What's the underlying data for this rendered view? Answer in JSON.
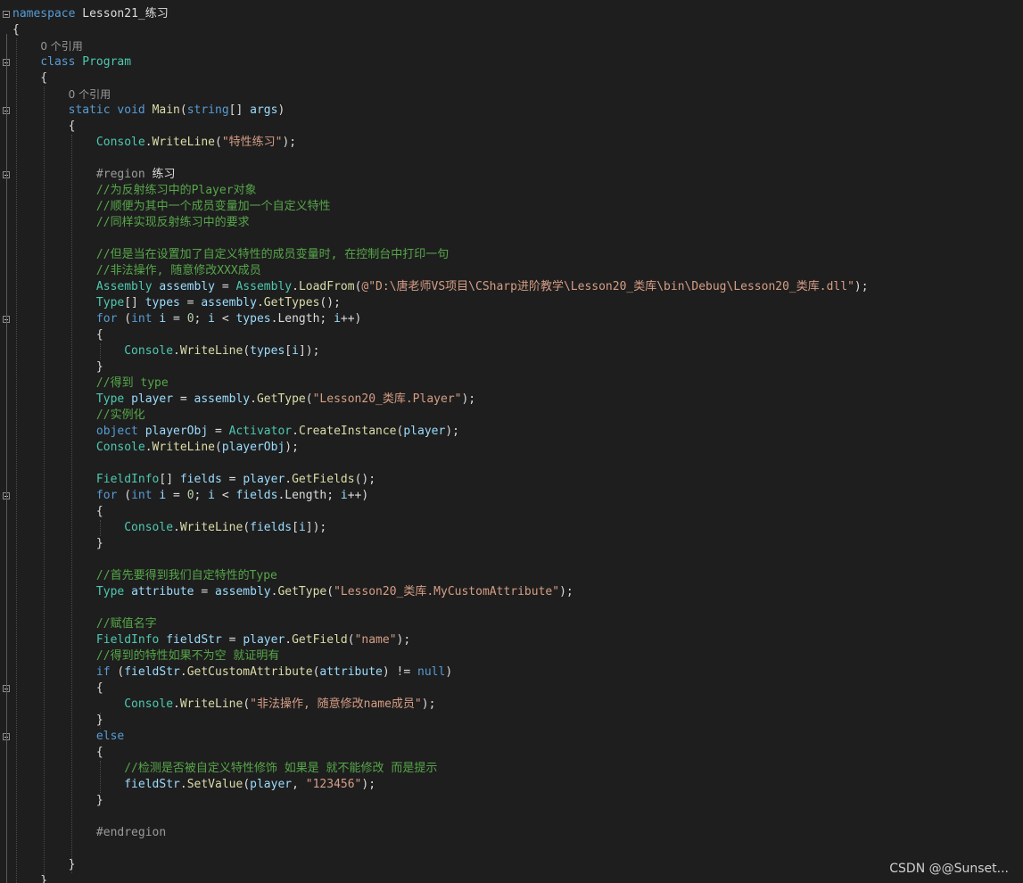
{
  "editor": {
    "code_lens": "0 个引用",
    "lines": [
      [
        [
          "kw",
          "namespace"
        ],
        [
          "pl",
          " Lesson21_练习"
        ]
      ],
      [
        [
          "pl",
          "{"
        ]
      ],
      [
        "lens"
      ],
      [
        [
          "pl",
          "    "
        ],
        [
          "kw",
          "class"
        ],
        [
          "pl",
          " "
        ],
        [
          "ty",
          "Program"
        ]
      ],
      [
        [
          "pl",
          "    {"
        ]
      ],
      [
        "lens"
      ],
      [
        [
          "pl",
          "        "
        ],
        [
          "kw",
          "static"
        ],
        [
          "pl",
          " "
        ],
        [
          "kw",
          "void"
        ],
        [
          "pl",
          " "
        ],
        [
          "fn",
          "Main"
        ],
        [
          "pl",
          "("
        ],
        [
          "kw",
          "string"
        ],
        [
          "pl",
          "[] "
        ],
        [
          "id",
          "args"
        ],
        [
          "pl",
          ")"
        ]
      ],
      [
        [
          "pl",
          "        {"
        ]
      ],
      [
        [
          "pl",
          "            "
        ],
        [
          "ty",
          "Console"
        ],
        [
          "pl",
          "."
        ],
        [
          "fn",
          "WriteLine"
        ],
        [
          "pl",
          "("
        ],
        [
          "str",
          "\"特性练习\""
        ],
        [
          "pl",
          ");"
        ]
      ],
      [],
      [
        [
          "pl",
          "            "
        ],
        [
          "pre",
          "#region"
        ],
        [
          "pl",
          " 练习"
        ]
      ],
      [
        [
          "pl",
          "            "
        ],
        [
          "cm",
          "//为反射练习中的Player对象"
        ]
      ],
      [
        [
          "pl",
          "            "
        ],
        [
          "cm",
          "//顺便为其中一个成员变量加一个自定义特性"
        ]
      ],
      [
        [
          "pl",
          "            "
        ],
        [
          "cm",
          "//同样实现反射练习中的要求"
        ]
      ],
      [],
      [
        [
          "pl",
          "            "
        ],
        [
          "cm",
          "//但是当在设置加了自定义特性的成员变量时, 在控制台中打印一句"
        ]
      ],
      [
        [
          "pl",
          "            "
        ],
        [
          "cm",
          "//非法操作, 随意修改XXX成员"
        ]
      ],
      [
        [
          "pl",
          "            "
        ],
        [
          "ty",
          "Assembly"
        ],
        [
          "pl",
          " "
        ],
        [
          "id",
          "assembly"
        ],
        [
          "pl",
          " = "
        ],
        [
          "ty",
          "Assembly"
        ],
        [
          "pl",
          "."
        ],
        [
          "fn",
          "LoadFrom"
        ],
        [
          "pl",
          "("
        ],
        [
          "str",
          "@\"D:\\唐老师VS项目\\CSharp进阶教学\\Lesson20_类库\\bin\\Debug\\Lesson20_类库.dll\""
        ],
        [
          "pl",
          ");"
        ]
      ],
      [
        [
          "pl",
          "            "
        ],
        [
          "ty",
          "Type"
        ],
        [
          "pl",
          "[] "
        ],
        [
          "id",
          "types"
        ],
        [
          "pl",
          " = "
        ],
        [
          "id",
          "assembly"
        ],
        [
          "pl",
          "."
        ],
        [
          "fn",
          "GetTypes"
        ],
        [
          "pl",
          "();"
        ]
      ],
      [
        [
          "pl",
          "            "
        ],
        [
          "kw",
          "for"
        ],
        [
          "pl",
          " ("
        ],
        [
          "kw",
          "int"
        ],
        [
          "pl",
          " "
        ],
        [
          "id",
          "i"
        ],
        [
          "pl",
          " = "
        ],
        [
          "num",
          "0"
        ],
        [
          "pl",
          "; "
        ],
        [
          "id",
          "i"
        ],
        [
          "pl",
          " < "
        ],
        [
          "id",
          "types"
        ],
        [
          "pl",
          ".Length; "
        ],
        [
          "id",
          "i"
        ],
        [
          "pl",
          "++)"
        ]
      ],
      [
        [
          "pl",
          "            {"
        ]
      ],
      [
        [
          "pl",
          "                "
        ],
        [
          "ty",
          "Console"
        ],
        [
          "pl",
          "."
        ],
        [
          "fn",
          "WriteLine"
        ],
        [
          "pl",
          "("
        ],
        [
          "id",
          "types"
        ],
        [
          "pl",
          "["
        ],
        [
          "id",
          "i"
        ],
        [
          "pl",
          "]);"
        ]
      ],
      [
        [
          "pl",
          "            }"
        ]
      ],
      [
        [
          "pl",
          "            "
        ],
        [
          "cm",
          "//得到 type"
        ]
      ],
      [
        [
          "pl",
          "            "
        ],
        [
          "ty",
          "Type"
        ],
        [
          "pl",
          " "
        ],
        [
          "id",
          "player"
        ],
        [
          "pl",
          " = "
        ],
        [
          "id",
          "assembly"
        ],
        [
          "pl",
          "."
        ],
        [
          "fn",
          "GetType"
        ],
        [
          "pl",
          "("
        ],
        [
          "str",
          "\"Lesson20_类库.Player\""
        ],
        [
          "pl",
          ");"
        ]
      ],
      [
        [
          "pl",
          "            "
        ],
        [
          "cm",
          "//实例化"
        ]
      ],
      [
        [
          "pl",
          "            "
        ],
        [
          "kw",
          "object"
        ],
        [
          "pl",
          " "
        ],
        [
          "id",
          "playerObj"
        ],
        [
          "pl",
          " = "
        ],
        [
          "ty",
          "Activator"
        ],
        [
          "pl",
          "."
        ],
        [
          "fn",
          "CreateInstance"
        ],
        [
          "pl",
          "("
        ],
        [
          "id",
          "player"
        ],
        [
          "pl",
          ");"
        ]
      ],
      [
        [
          "pl",
          "            "
        ],
        [
          "ty",
          "Console"
        ],
        [
          "pl",
          "."
        ],
        [
          "fn",
          "WriteLine"
        ],
        [
          "pl",
          "("
        ],
        [
          "id",
          "playerObj"
        ],
        [
          "pl",
          ");"
        ]
      ],
      [],
      [
        [
          "pl",
          "            "
        ],
        [
          "ty",
          "FieldInfo"
        ],
        [
          "pl",
          "[] "
        ],
        [
          "id",
          "fields"
        ],
        [
          "pl",
          " = "
        ],
        [
          "id",
          "player"
        ],
        [
          "pl",
          "."
        ],
        [
          "fn",
          "GetFields"
        ],
        [
          "pl",
          "();"
        ]
      ],
      [
        [
          "pl",
          "            "
        ],
        [
          "kw",
          "for"
        ],
        [
          "pl",
          " ("
        ],
        [
          "kw",
          "int"
        ],
        [
          "pl",
          " "
        ],
        [
          "id",
          "i"
        ],
        [
          "pl",
          " = "
        ],
        [
          "num",
          "0"
        ],
        [
          "pl",
          "; "
        ],
        [
          "id",
          "i"
        ],
        [
          "pl",
          " < "
        ],
        [
          "id",
          "fields"
        ],
        [
          "pl",
          ".Length; "
        ],
        [
          "id",
          "i"
        ],
        [
          "pl",
          "++)"
        ]
      ],
      [
        [
          "pl",
          "            {"
        ]
      ],
      [
        [
          "pl",
          "                "
        ],
        [
          "ty",
          "Console"
        ],
        [
          "pl",
          "."
        ],
        [
          "fn",
          "WriteLine"
        ],
        [
          "pl",
          "("
        ],
        [
          "id",
          "fields"
        ],
        [
          "pl",
          "["
        ],
        [
          "id",
          "i"
        ],
        [
          "pl",
          "]);"
        ]
      ],
      [
        [
          "pl",
          "            }"
        ]
      ],
      [],
      [
        [
          "pl",
          "            "
        ],
        [
          "cm",
          "//首先要得到我们自定特性的Type"
        ]
      ],
      [
        [
          "pl",
          "            "
        ],
        [
          "ty",
          "Type"
        ],
        [
          "pl",
          " "
        ],
        [
          "id",
          "attribute"
        ],
        [
          "pl",
          " = "
        ],
        [
          "id",
          "assembly"
        ],
        [
          "pl",
          "."
        ],
        [
          "fn",
          "GetType"
        ],
        [
          "pl",
          "("
        ],
        [
          "str",
          "\"Lesson20_类库.MyCustomAttribute\""
        ],
        [
          "pl",
          ");"
        ]
      ],
      [],
      [
        [
          "pl",
          "            "
        ],
        [
          "cm",
          "//赋值名字"
        ]
      ],
      [
        [
          "pl",
          "            "
        ],
        [
          "ty",
          "FieldInfo"
        ],
        [
          "pl",
          " "
        ],
        [
          "id",
          "fieldStr"
        ],
        [
          "pl",
          " = "
        ],
        [
          "id",
          "player"
        ],
        [
          "pl",
          "."
        ],
        [
          "fn",
          "GetField"
        ],
        [
          "pl",
          "("
        ],
        [
          "str",
          "\"name\""
        ],
        [
          "pl",
          ");"
        ]
      ],
      [
        [
          "pl",
          "            "
        ],
        [
          "cm",
          "//得到的特性如果不为空 就证明有"
        ]
      ],
      [
        [
          "pl",
          "            "
        ],
        [
          "kw",
          "if"
        ],
        [
          "pl",
          " ("
        ],
        [
          "id",
          "fieldStr"
        ],
        [
          "pl",
          "."
        ],
        [
          "fn",
          "GetCustomAttribute"
        ],
        [
          "pl",
          "("
        ],
        [
          "id",
          "attribute"
        ],
        [
          "pl",
          ") != "
        ],
        [
          "kw",
          "null"
        ],
        [
          "pl",
          ")"
        ]
      ],
      [
        [
          "pl",
          "            {"
        ]
      ],
      [
        [
          "pl",
          "                "
        ],
        [
          "ty",
          "Console"
        ],
        [
          "pl",
          "."
        ],
        [
          "fn",
          "WriteLine"
        ],
        [
          "pl",
          "("
        ],
        [
          "str",
          "\"非法操作, 随意修改name成员\""
        ],
        [
          "pl",
          ");"
        ]
      ],
      [
        [
          "pl",
          "            }"
        ]
      ],
      [
        [
          "pl",
          "            "
        ],
        [
          "kw",
          "else"
        ]
      ],
      [
        [
          "pl",
          "            {"
        ]
      ],
      [
        [
          "pl",
          "                "
        ],
        [
          "cm",
          "//检测是否被自定义特性修饰 如果是 就不能修改 而是提示"
        ]
      ],
      [
        [
          "pl",
          "                "
        ],
        [
          "id",
          "fieldStr"
        ],
        [
          "pl",
          "."
        ],
        [
          "fn",
          "SetValue"
        ],
        [
          "pl",
          "("
        ],
        [
          "id",
          "player"
        ],
        [
          "pl",
          ", "
        ],
        [
          "str",
          "\"123456\""
        ],
        [
          "pl",
          ");"
        ]
      ],
      [
        [
          "pl",
          "            }"
        ]
      ],
      [],
      [
        [
          "pl",
          "            "
        ],
        [
          "pre",
          "#endregion"
        ]
      ],
      [],
      [
        [
          "pl",
          "        }"
        ]
      ],
      [
        [
          "pl",
          "    }"
        ]
      ]
    ]
  },
  "fold_markers": [
    0,
    3,
    6,
    10,
    19,
    30,
    42,
    45
  ],
  "watermark": "CSDN @@Sunset..."
}
